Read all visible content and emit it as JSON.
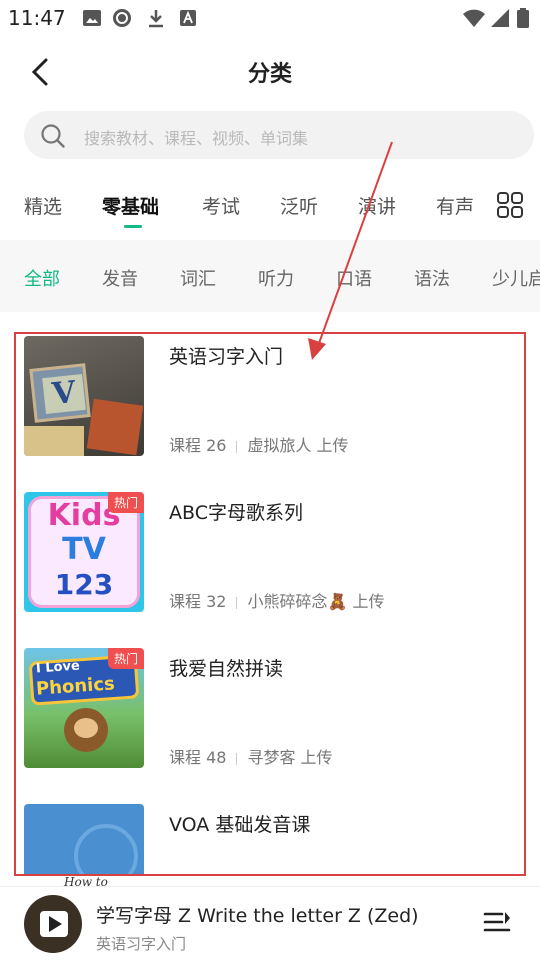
{
  "status": {
    "time": "11:47"
  },
  "header": {
    "title": "分类"
  },
  "search": {
    "placeholder": "搜索教材、课程、视频、单词集"
  },
  "tabs": [
    "精选",
    "零基础",
    "考试",
    "泛听",
    "演讲",
    "有声"
  ],
  "active_tab": "零基础",
  "subcategories": [
    "全部",
    "发音",
    "词汇",
    "听力",
    "口语",
    "语法",
    "少儿启"
  ],
  "active_sub": "全部",
  "items": [
    {
      "title": "英语习字入门",
      "lessons": "课程 26",
      "uploader": "虚拟旅人 上传",
      "hot": ""
    },
    {
      "title": "ABC字母歌系列",
      "lessons": "课程 32",
      "uploader": "小熊碎碎念🧸 上传",
      "hot": "热门"
    },
    {
      "title": "我爱自然拼读",
      "lessons": "课程 48",
      "uploader": "寻梦客 上传",
      "hot": "热门"
    },
    {
      "title": "VOA 基础发音课",
      "lessons": "",
      "uploader": "",
      "hot": ""
    }
  ],
  "thumb_text": {
    "kids1": "Kids",
    "kids2": "TV",
    "kids3": "123",
    "phonics1": "I Love",
    "phonics2": "Phonics",
    "block": "V"
  },
  "player": {
    "cover_text": "How to",
    "title": "学写字母 Z Write the letter Z (Zed)",
    "subtitle": "英语习字入门"
  },
  "colors": {
    "accent": "#12b886",
    "hot": "#f04f4f",
    "annotation": "#d94040"
  },
  "icons": {
    "back": "chevron-left-icon",
    "search": "search-icon",
    "grid": "grid-icon",
    "playlist": "playlist-icon",
    "play": "play-icon"
  }
}
